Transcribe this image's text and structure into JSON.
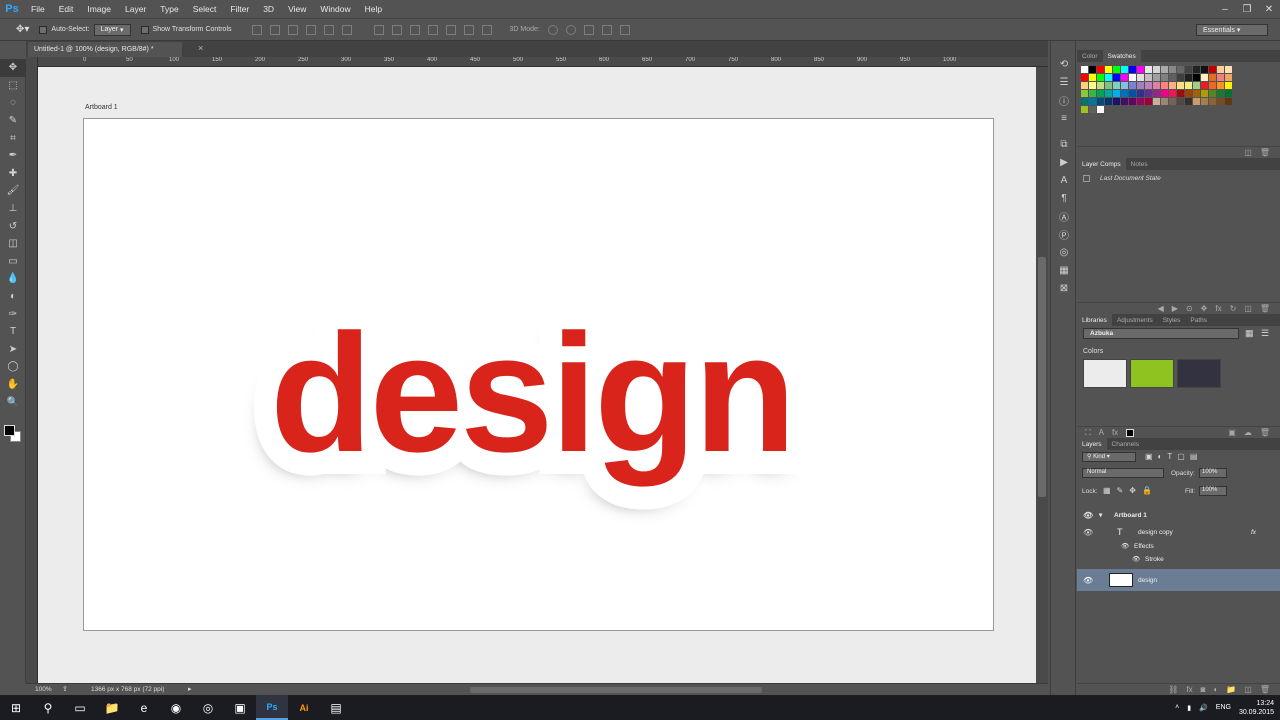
{
  "app": {
    "logo": "Ps"
  },
  "menu": [
    "File",
    "Edit",
    "Image",
    "Layer",
    "Type",
    "Select",
    "Filter",
    "3D",
    "View",
    "Window",
    "Help"
  ],
  "window_controls": [
    "–",
    "❐",
    "✕"
  ],
  "options_bar": {
    "auto_select_label": "Auto-Select:",
    "auto_select_value": "Layer",
    "show_transform_label": "Show Transform Controls",
    "mode_label": "3D Mode:",
    "workspace": "Essentials"
  },
  "document": {
    "tab_title": "Untitled-1 @ 100% (design, RGB/8#) *",
    "tab_close": "×",
    "artboard_label": "Artboard 1",
    "canvas_text": "design",
    "zoom": "100%",
    "doc_size": "1366 px x 768 px (72 ppi)"
  },
  "ruler_ticks": [
    "0",
    "50",
    "100",
    "150",
    "200",
    "250",
    "300",
    "350",
    "400",
    "450",
    "500",
    "550",
    "600",
    "650",
    "700",
    "750",
    "800",
    "850",
    "900",
    "950",
    "1000"
  ],
  "tools": [
    "move-tool",
    "artboard-tool",
    "lasso-tool",
    "quick-select-tool",
    "crop-tool",
    "eyedropper-tool",
    "healing-tool",
    "brush-tool",
    "stamp-tool",
    "history-brush-tool",
    "eraser-tool",
    "gradient-tool",
    "blur-tool",
    "dodge-tool",
    "pen-tool",
    "type-tool",
    "path-select-tool",
    "shape-tool",
    "hand-tool",
    "zoom-tool"
  ],
  "tool_glyphs": [
    "✥",
    "⬚",
    "◌",
    "✎",
    "⌗",
    "✒",
    "✚",
    "🖌",
    "⊥",
    "↺",
    "◫",
    "▭",
    "💧",
    "◐",
    "✑",
    "T",
    "➤",
    "◯",
    "✋",
    "🔍"
  ],
  "color_panel": {
    "tabs": [
      "Color",
      "Swatches"
    ],
    "active_tab": "Swatches",
    "swatches": [
      "#ffffff",
      "#000000",
      "#ff0000",
      "#ffff00",
      "#00ff00",
      "#00ffff",
      "#0000ff",
      "#ff00ff",
      "#e8e8e8",
      "#d4d4d4",
      "#aaaaaa",
      "#888888",
      "#666666",
      "#444444",
      "#222222",
      "#111111",
      "#c00000",
      "#ffcc99",
      "#ffe0b0",
      "#ff0000",
      "#ffff00",
      "#00ff00",
      "#00ffff",
      "#0000ff",
      "#ff00ff",
      "#ffffff",
      "#e0e0e0",
      "#c0c0c0",
      "#a0a0a0",
      "#808080",
      "#606060",
      "#404040",
      "#202020",
      "#000000",
      "#fff0c0",
      "#e07020",
      "#f08080",
      "#f4a460",
      "#fdd080",
      "#ffff80",
      "#c0e080",
      "#80c080",
      "#80d0c0",
      "#80c0e0",
      "#8080d0",
      "#a080c0",
      "#c080c0",
      "#e080a0",
      "#ff8080",
      "#ffb080",
      "#ffe080",
      "#f0f080",
      "#a0d080",
      "#ed1c24",
      "#f26522",
      "#f7941d",
      "#fff200",
      "#8dc63f",
      "#39b54a",
      "#00a651",
      "#00a99d",
      "#00aeef",
      "#0072bc",
      "#0054a6",
      "#2e3192",
      "#662d91",
      "#92278f",
      "#ec008c",
      "#ed145b",
      "#9e0b0f",
      "#a0410d",
      "#a36209",
      "#aba000",
      "#598527",
      "#1a7b30",
      "#007236",
      "#00746b",
      "#0076a3",
      "#004b80",
      "#003471",
      "#1b1464",
      "#440e62",
      "#630460",
      "#9e005d",
      "#9e0039",
      "#c7b299",
      "#998675",
      "#736357",
      "#534741",
      "#37302a",
      "#c69c6d",
      "#a67c52",
      "#8c6239",
      "#754c24",
      "#603913",
      "#a0c020",
      "#606060",
      "#ffffff"
    ]
  },
  "layer_comps": {
    "tabs": [
      "Layer Comps",
      "Notes"
    ],
    "state": "Last Document State"
  },
  "libraries": {
    "tabs": [
      "Libraries",
      "Adjustments",
      "Styles",
      "Paths"
    ],
    "library_name": "Azbuka",
    "colors_label": "Colors",
    "colors": [
      "#ececec",
      "#8fc31f",
      "#323240"
    ]
  },
  "layers_panel": {
    "tabs": [
      "Layers",
      "Channels"
    ],
    "kind": "Kind",
    "blend_mode": "Normal",
    "opacity_label": "Opacity:",
    "opacity": "100%",
    "lock_label": "Lock:",
    "fill_label": "Fill:",
    "fill": "100%",
    "layers": [
      {
        "name": "Artboard 1",
        "type": "artboard"
      },
      {
        "name": "design copy",
        "type": "text",
        "fx": "fx"
      },
      {
        "name": "Effects",
        "type": "effects"
      },
      {
        "name": "Stroke",
        "type": "effect"
      },
      {
        "name": "design",
        "type": "smart",
        "selected": true
      }
    ]
  },
  "taskbar": {
    "apps": [
      "windows-start",
      "search",
      "task-view",
      "file-explorer",
      "edge",
      "firefox",
      "chrome",
      "app-misc",
      "photoshop",
      "illustrator",
      "app-other"
    ],
    "app_glyphs": [
      "⊞",
      "⚲",
      "▭",
      "📁",
      "e",
      "◉",
      "◎",
      "▣",
      "Ps",
      "Ai",
      "▤"
    ],
    "language": "ENG",
    "time": "13:24",
    "date": "30.09.2015"
  },
  "accent": "#31a8ff",
  "design_red": "#d9241c"
}
